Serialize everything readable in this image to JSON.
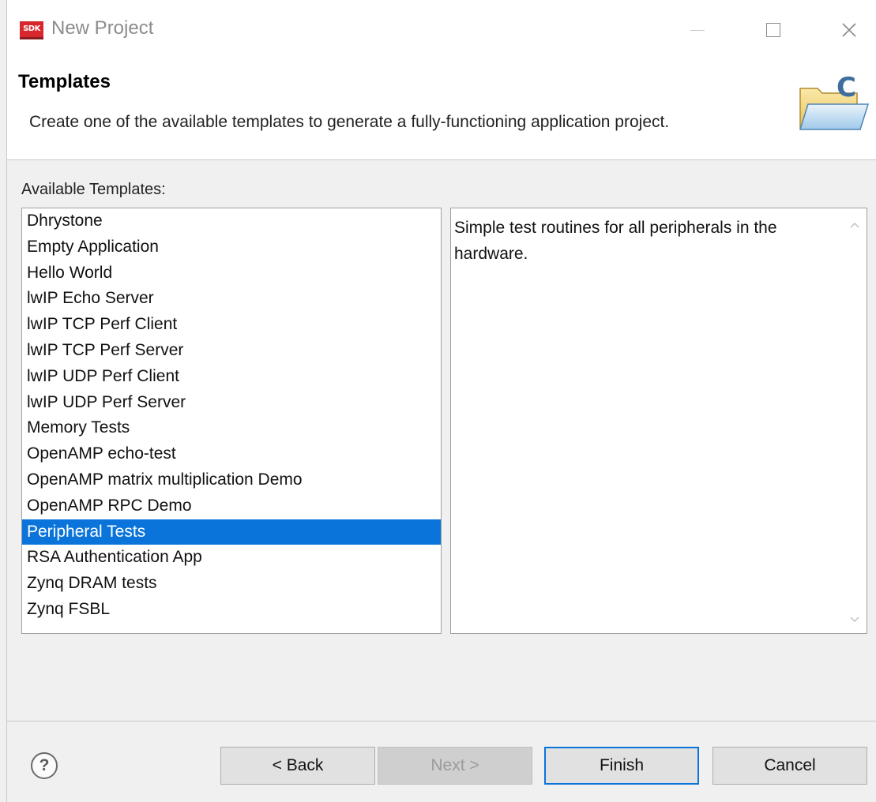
{
  "window": {
    "title": "New Project",
    "app_icon_text": "SDK",
    "controls": [
      "minimize-icon",
      "maximize-icon",
      "close-icon"
    ]
  },
  "header": {
    "title": "Templates",
    "description": "Create one of the available templates to generate a fully-functioning application project.",
    "icon": "new-c-project-folder-icon"
  },
  "templates": {
    "label": "Available Templates:",
    "items": [
      {
        "label": "Dhrystone"
      },
      {
        "label": "Empty Application"
      },
      {
        "label": "Hello World"
      },
      {
        "label": "lwIP Echo Server"
      },
      {
        "label": "lwIP TCP Perf Client"
      },
      {
        "label": "lwIP TCP Perf Server"
      },
      {
        "label": "lwIP UDP Perf Client"
      },
      {
        "label": "lwIP UDP Perf Server"
      },
      {
        "label": "Memory Tests"
      },
      {
        "label": "OpenAMP echo-test"
      },
      {
        "label": "OpenAMP matrix multiplication Demo"
      },
      {
        "label": "OpenAMP RPC Demo"
      },
      {
        "label": "Peripheral Tests",
        "selected": true
      },
      {
        "label": "RSA Authentication App"
      },
      {
        "label": "Zynq DRAM tests"
      },
      {
        "label": "Zynq FSBL"
      }
    ],
    "selected_description": "Simple test routines for all peripherals in the hardware."
  },
  "footer": {
    "help_icon": "?",
    "back_label": "< Back",
    "next_label": "Next >",
    "finish_label": "Finish",
    "cancel_label": "Cancel"
  },
  "colors": {
    "selection": "#0a74da",
    "app_icon": "#d7262c",
    "default_button_border": "#0a74da"
  }
}
